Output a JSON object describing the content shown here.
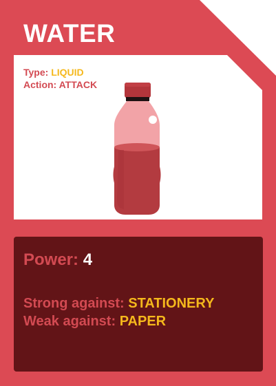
{
  "card": {
    "title": "WATER",
    "type_label": "Type:",
    "type_value": "LIQUID",
    "action_label": "Action:",
    "action_value": "ATTACK",
    "image_icon": "water-bottle-icon",
    "power_label": "Power:",
    "power_value": "4",
    "strong_label": "Strong against:",
    "strong_value": "STATIONERY",
    "weak_label": "Weak against:",
    "weak_value": "PAPER"
  },
  "colors": {
    "card_red": "#dc4a54",
    "stats_bg": "#621417",
    "accent_yellow": "#f5b81c",
    "label_red": "#d34a52"
  }
}
